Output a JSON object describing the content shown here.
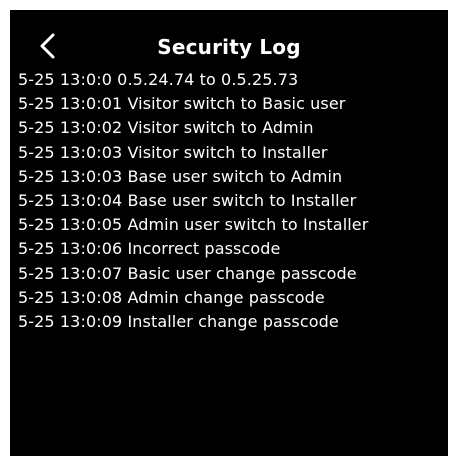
{
  "header": {
    "title": "Security Log",
    "back_icon": "chevron-left-icon"
  },
  "log": {
    "entries": [
      "5-25 13:0:0 0.5.24.74 to 0.5.25.73",
      "5-25 13:0:01 Visitor switch to Basic user",
      "5-25 13:0:02 Visitor switch to Admin",
      "5-25 13:0:03 Visitor switch to Installer",
      "5-25 13:0:03 Base user switch to Admin",
      "5-25 13:0:04 Base user switch to Installer",
      "5-25 13:0:05 Admin user switch to Installer",
      "5-25 13:0:06 Incorrect passcode",
      "5-25 13:0:07 Basic user change passcode",
      "5-25 13:0:08 Admin change passcode",
      "5-25 13:0:09 Installer change passcode"
    ]
  },
  "colors": {
    "background": "#000000",
    "text": "#ffffff",
    "frame": "#ffffff"
  }
}
